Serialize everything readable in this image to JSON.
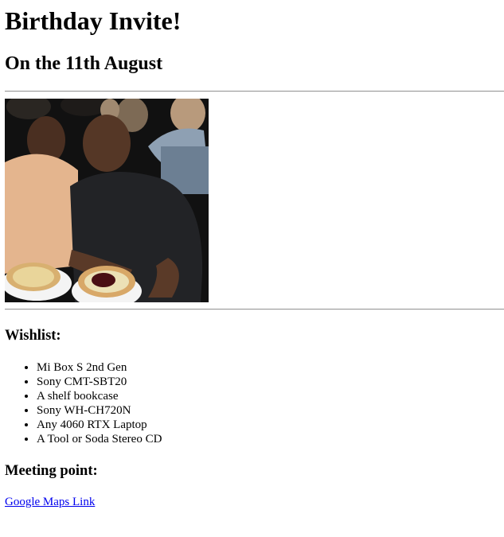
{
  "title": "Birthday Invite!",
  "date_heading": "On the 11th August",
  "wishlist": {
    "heading": "Wishlist:",
    "items": [
      "Mi Box S 2nd Gen",
      "Sony CMT-SBT20",
      "A shelf bookcase",
      "Sony WH-CH720N",
      "Any 4060 RTX Laptop",
      "A Tool or Soda Stereo CD"
    ]
  },
  "meeting": {
    "heading": "Meeting point:",
    "link_label": "Google Maps Link"
  },
  "colors": {
    "link": "#0000ee",
    "text": "#000000",
    "rule": "#9a9a9a"
  }
}
